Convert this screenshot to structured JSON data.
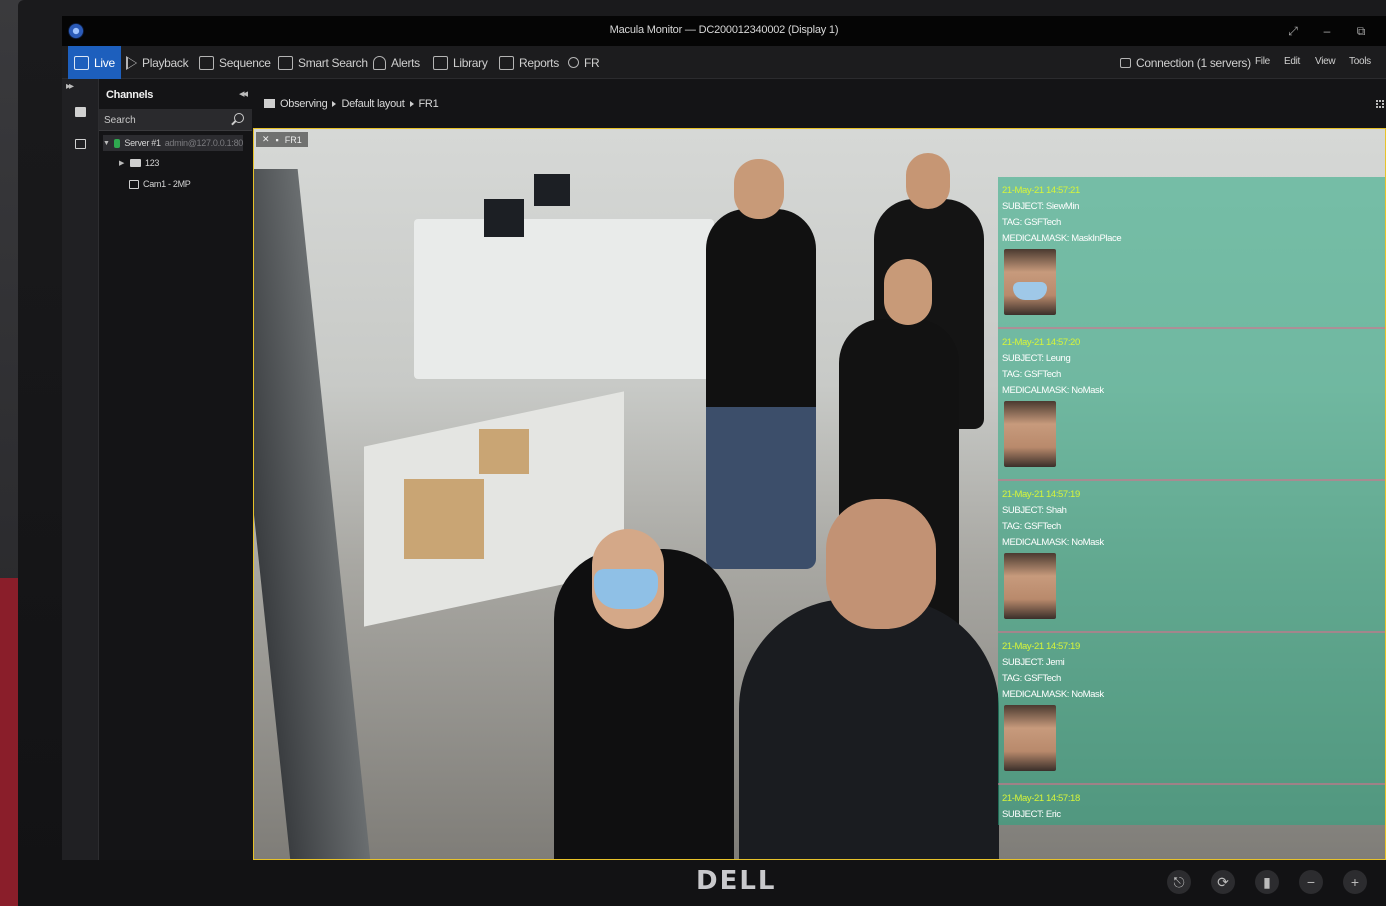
{
  "window": {
    "title": "Macula Monitor — DC200012340002 (Display 1)",
    "controls": [
      "⤢",
      "–",
      "⧉"
    ]
  },
  "toolbar": {
    "tabs": [
      {
        "label": "Live",
        "icon": "monitor-icon",
        "active": true
      },
      {
        "label": "Playback",
        "icon": "play-icon"
      },
      {
        "label": "Sequence",
        "icon": "sequence-icon"
      },
      {
        "label": "Smart Search",
        "icon": "smart-search-icon"
      },
      {
        "label": "Alerts",
        "icon": "bell-icon"
      },
      {
        "label": "Library",
        "icon": "library-icon"
      },
      {
        "label": "Reports",
        "icon": "reports-icon"
      },
      {
        "label": "FR",
        "icon": "person-icon"
      }
    ],
    "connection": "Connection (1 servers)",
    "menus": [
      "File",
      "Edit",
      "View",
      "Tools"
    ]
  },
  "channels": {
    "header": "Channels",
    "search_placeholder": "Search",
    "tree": {
      "server": "Server #1",
      "server_sub": "admin@127.0.0.1:80",
      "folder": "123",
      "camera": "Cam1 - 2MP"
    }
  },
  "breadcrumb": [
    "Observing",
    "Default layout",
    "FR1"
  ],
  "video": {
    "tile_label": "FR1",
    "detections": [
      {
        "time": "21-May-21 14:57:21",
        "subject": "SUBJECT: SiewMin",
        "tag": "TAG: GSFTech",
        "mask": "MEDICALMASK: MaskInPlace",
        "masked": true
      },
      {
        "time": "21-May-21 14:57:20",
        "subject": "SUBJECT: Leung",
        "tag": "TAG: GSFTech",
        "mask": "MEDICALMASK: NoMask",
        "masked": false
      },
      {
        "time": "21-May-21 14:57:19",
        "subject": "SUBJECT: Shah",
        "tag": "TAG: GSFTech",
        "mask": "MEDICALMASK: NoMask",
        "masked": false
      },
      {
        "time": "21-May-21 14:57:19",
        "subject": "SUBJECT: Jemi",
        "tag": "TAG: GSFTech",
        "mask": "MEDICALMASK: NoMask",
        "masked": false
      },
      {
        "time": "21-May-21 14:57:18",
        "subject": "SUBJECT: Eric",
        "tag": "",
        "mask": "",
        "masked": false
      }
    ]
  },
  "monitor": {
    "brand": "DELL",
    "buttons": [
      "⎋",
      "⟳",
      "▮",
      "−",
      "+"
    ]
  },
  "colors": {
    "accent": "#1d5fbd",
    "tile_border": "#e7c22a",
    "overlay": "#28aa82",
    "timestamp": "#d6f43a"
  }
}
